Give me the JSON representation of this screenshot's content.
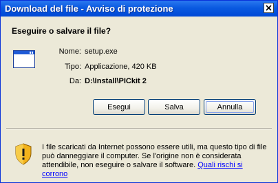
{
  "window": {
    "title": "Download del file - Avviso di protezione"
  },
  "dialog": {
    "question": "Eseguire o salvare il file?",
    "file_icon": "application-window-icon",
    "name_label": "Nome:",
    "name_value": "setup.exe",
    "type_label": "Tipo:",
    "type_value": "Applicazione, 420 KB",
    "from_label": "Da:",
    "from_value": "D:\\Install\\PICkit 2"
  },
  "buttons": {
    "run": "Esegui",
    "save": "Salva",
    "cancel": "Annulla"
  },
  "warning": {
    "icon": "security-shield-warning-icon",
    "text": "I file scaricati da Internet possono essere utili, ma questo tipo di file può danneggiare il computer. Se l'origine non è considerata attendibile, non eseguire o salvare il software. ",
    "link": "Quali rischi si corrono"
  }
}
